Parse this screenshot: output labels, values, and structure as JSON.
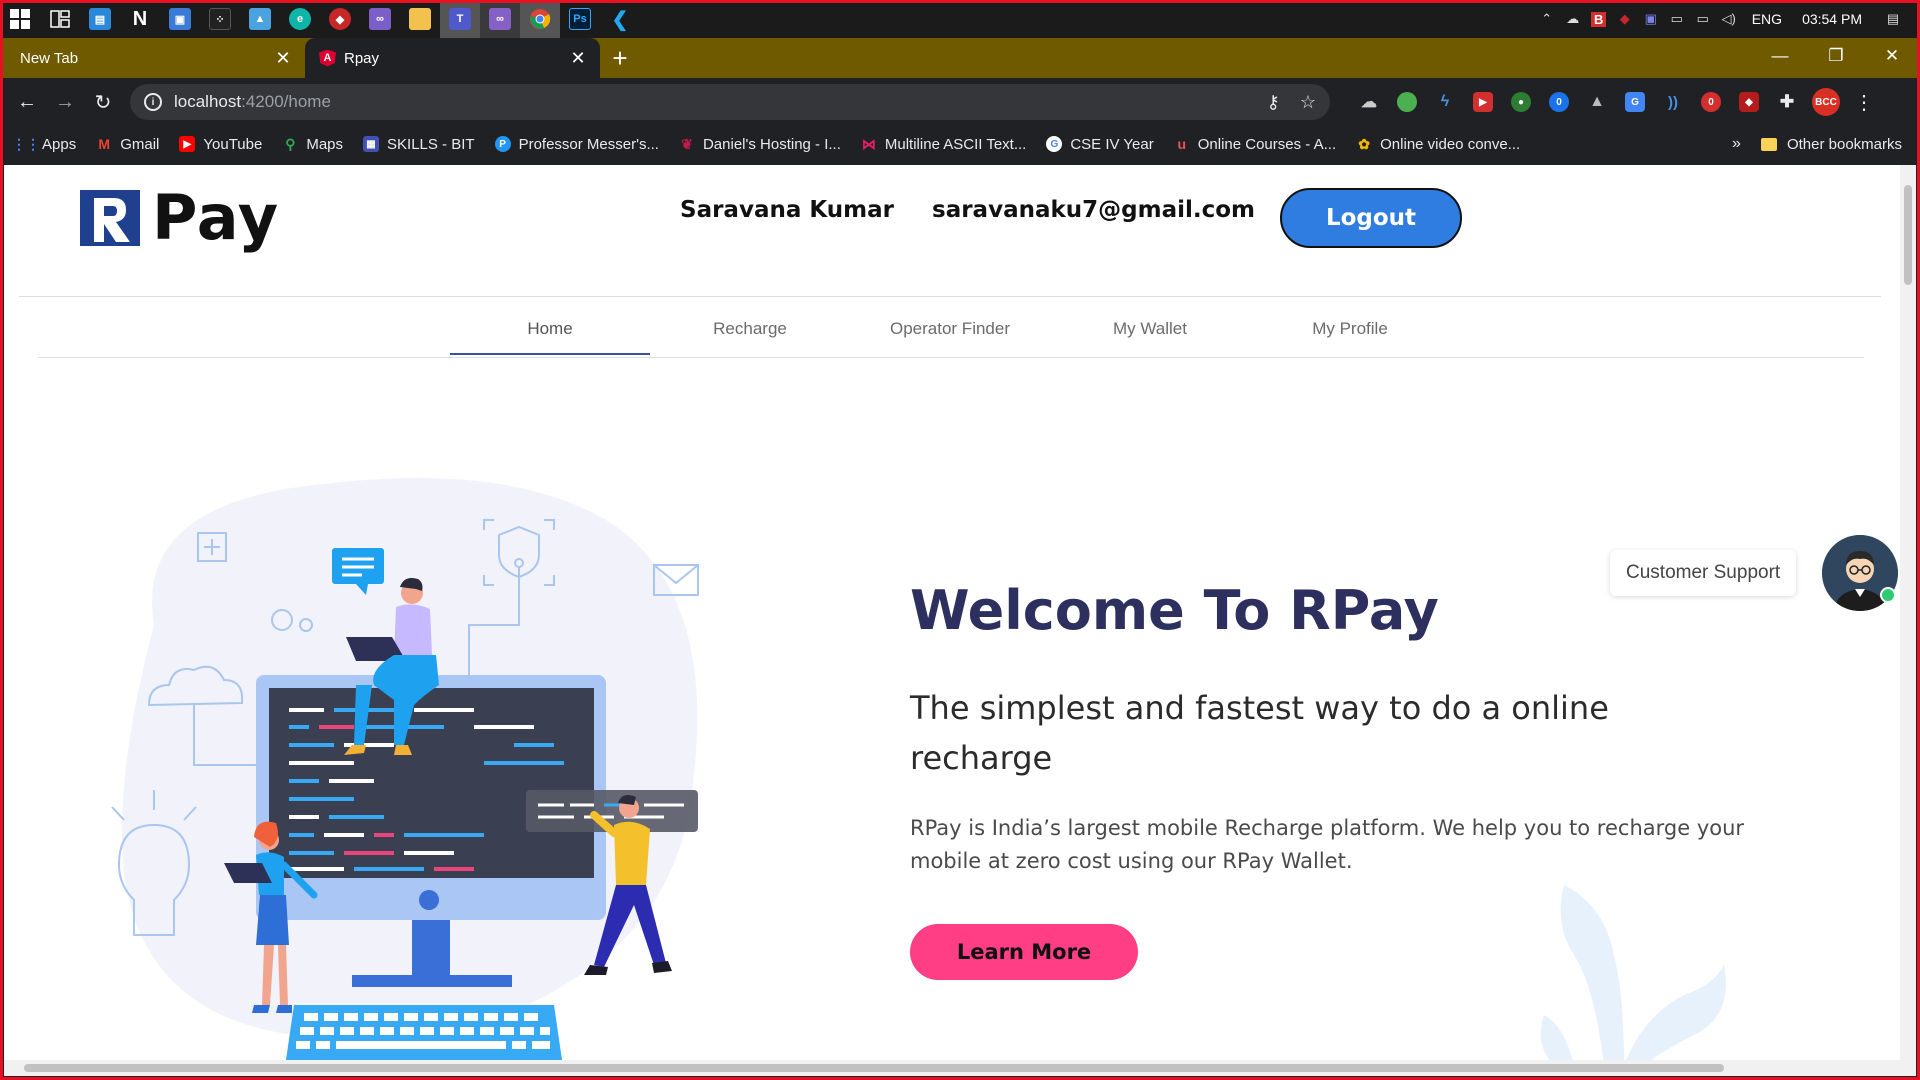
{
  "taskbar": {
    "apps": [
      {
        "icon": "windows-start-icon",
        "color": "#ffffff"
      },
      {
        "icon": "task-view-icon",
        "color": "#ffffff"
      },
      {
        "icon": "app-icon",
        "color": "#2b88d8"
      },
      {
        "icon": "notion-icon",
        "color": "#ffffff"
      },
      {
        "icon": "app-icon",
        "color": "#3a7bd5"
      },
      {
        "icon": "blackberry-icon",
        "color": "#222222"
      },
      {
        "icon": "photos-icon",
        "color": "#4aa3df"
      },
      {
        "icon": "edge-icon",
        "color": "#0fb5a8"
      },
      {
        "icon": "app-icon",
        "color": "#c62828"
      },
      {
        "icon": "visual-studio-icon",
        "color": "#7b5ec7"
      },
      {
        "icon": "file-explorer-icon",
        "color": "#f2c14e"
      },
      {
        "icon": "teams-icon",
        "color": "#5059c9"
      },
      {
        "icon": "visual-studio-icon",
        "color": "#8661c5"
      },
      {
        "icon": "chrome-icon",
        "color": "#f4b400"
      },
      {
        "icon": "photoshop-icon",
        "color": "#31a8ff"
      },
      {
        "icon": "vscode-icon",
        "color": "#23a9f2"
      }
    ],
    "language": "ENG",
    "time": "03:54 PM"
  },
  "browser": {
    "tabs": [
      {
        "label": "New Tab",
        "active": false
      },
      {
        "label": "Rpay",
        "active": true,
        "favicon": "A"
      }
    ],
    "url_host": "localhost",
    "url_path": ":4200/home",
    "profile_initials": "BCC",
    "bookmarks": [
      {
        "label": "Apps",
        "icon": "apps-grid-icon",
        "color": "#4285f4"
      },
      {
        "label": "Gmail",
        "icon": "gmail-icon",
        "color": "#ea4335"
      },
      {
        "label": "YouTube",
        "icon": "youtube-icon",
        "color": "#ff0000"
      },
      {
        "label": "Maps",
        "icon": "maps-icon",
        "color": "#34a853"
      },
      {
        "label": "SKILLS - BIT",
        "icon": "calendar-icon",
        "color": "#3f51b5"
      },
      {
        "label": "Professor Messer's...",
        "icon": "p-logo-icon",
        "color": "#2196f3"
      },
      {
        "label": "Daniel's Hosting - I...",
        "icon": "raspberry-icon",
        "color": "#c51a4a"
      },
      {
        "label": "Multiline ASCII Text...",
        "icon": "bow-icon",
        "color": "#e91e63"
      },
      {
        "label": "CSE IV Year",
        "icon": "google-icon",
        "color": "#ffffff"
      },
      {
        "label": "Online Courses - A...",
        "icon": "udemy-icon",
        "color": "#ec5252"
      },
      {
        "label": "Online video conve...",
        "icon": "video-converter-icon",
        "color": "#f5b800"
      }
    ],
    "other_bookmarks": "Other bookmarks"
  },
  "site": {
    "logo_text": "Pay",
    "user_name": "Saravana Kumar",
    "user_email": "saravanaku7@gmail.com",
    "logout_label": "Logout",
    "nav": [
      {
        "label": "Home",
        "active": true
      },
      {
        "label": "Recharge",
        "active": false
      },
      {
        "label": "Operator Finder",
        "active": false
      },
      {
        "label": "My Wallet",
        "active": false
      },
      {
        "label": "My Profile",
        "active": false
      }
    ],
    "hero": {
      "title": "Welcome To RPay",
      "subtitle": "The simplest and fastest way to do a online recharge",
      "description": "RPay is India’s largest mobile Recharge platform. We help you to recharge your mobile at zero cost using our RPay Wallet.",
      "cta_label": "Learn More"
    },
    "support_label": "Customer Support",
    "colors": {
      "brand_blue": "#2f7de1",
      "cta_pink": "#ff3e86",
      "title_navy": "#2d2f5e",
      "tabstrip_olive": "#6f5a00"
    }
  }
}
